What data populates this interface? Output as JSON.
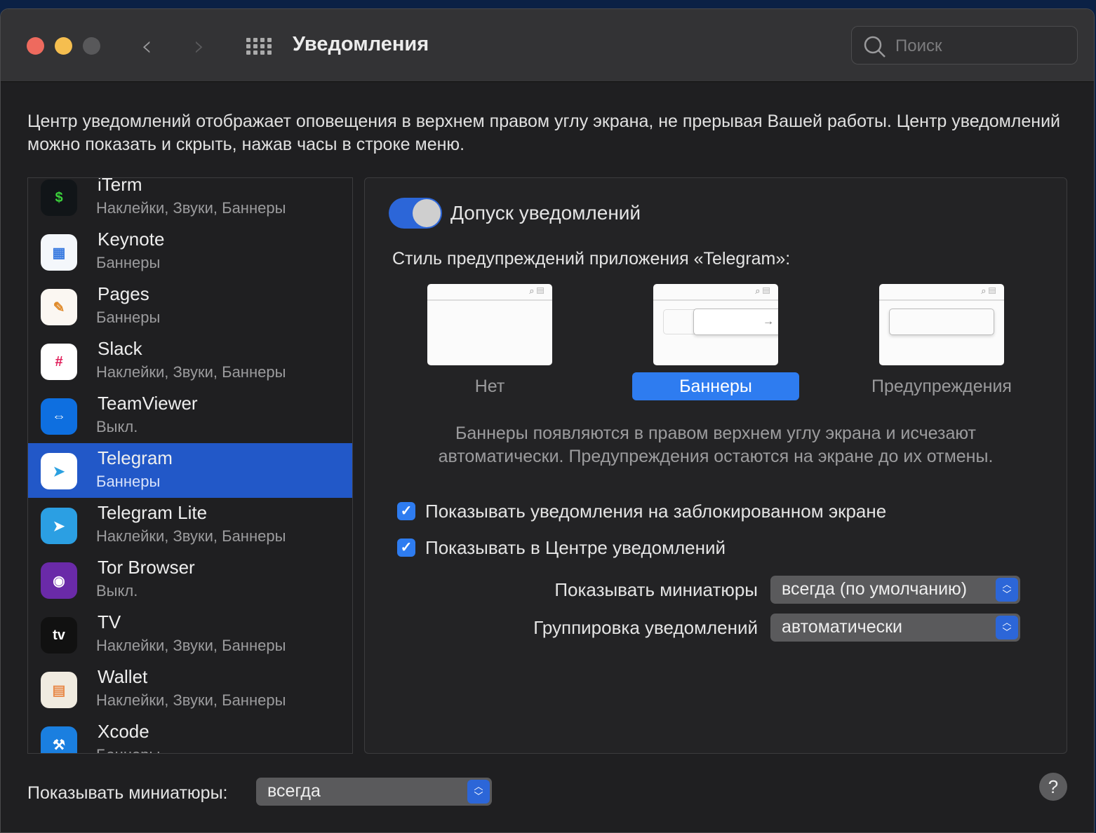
{
  "window": {
    "title": "Уведомления",
    "search_placeholder": "Поиск"
  },
  "description": "Центр уведомлений отображает оповещения в верхнем правом углу экрана, не прерывая Вашей работы. Центр уведомлений можно показать и скрыть, нажав часы в строке меню.",
  "apps": [
    {
      "name": "iTerm",
      "sub": "Наклейки, Звуки, Баннеры",
      "icon": "$",
      "bg": "#111518",
      "fg": "#3bd13b"
    },
    {
      "name": "Keynote",
      "sub": "Баннеры",
      "icon": "▦",
      "bg": "#f4f7fb",
      "fg": "#3a7be0"
    },
    {
      "name": "Pages",
      "sub": "Баннеры",
      "icon": "✎",
      "bg": "#fbf7f2",
      "fg": "#e08a2a"
    },
    {
      "name": "Slack",
      "sub": "Наклейки, Звуки, Баннеры",
      "icon": "#",
      "bg": "#ffffff",
      "fg": "#e01e5a"
    },
    {
      "name": "TeamViewer",
      "sub": "Выкл.",
      "icon": "⇔",
      "bg": "#0e6fe0",
      "fg": "#ffffff"
    },
    {
      "name": "Telegram",
      "sub": "Баннеры",
      "icon": "➤",
      "bg": "#ffffff",
      "fg": "#2aa0e0"
    },
    {
      "name": "Telegram Lite",
      "sub": "Наклейки, Звуки, Баннеры",
      "icon": "➤",
      "bg": "#2b9fe3",
      "fg": "#ffffff"
    },
    {
      "name": "Tor Browser",
      "sub": "Выкл.",
      "icon": "◉",
      "bg": "#6a2aa8",
      "fg": "#ffffff"
    },
    {
      "name": "TV",
      "sub": "Наклейки, Звуки, Баннеры",
      "icon": "tv",
      "bg": "#111",
      "fg": "#ffffff"
    },
    {
      "name": "Wallet",
      "sub": "Наклейки, Звуки, Баннеры",
      "icon": "▤",
      "bg": "#f0ebe0",
      "fg": "#e88a4a"
    },
    {
      "name": "Xcode",
      "sub": "Баннеры",
      "icon": "⚒",
      "bg": "#1a7fe0",
      "fg": "#ffffff"
    }
  ],
  "selected_app": "Telegram",
  "pane": {
    "allow_label": "Допуск уведомлений",
    "allow_on": true,
    "style_label": "Стиль предупреждений приложения «Telegram»:",
    "styles": [
      "Нет",
      "Баннеры",
      "Предупреждения"
    ],
    "style_selected": "Баннеры",
    "note": "Баннеры появляются в правом верхнем углу экрана и исчезают автоматически. Предупреждения остаются на экране до их отмены.",
    "cb_lock": "Показывать уведомления на заблокированном экране",
    "cb_lock_checked": true,
    "cb_center": "Показывать в Центре уведомлений",
    "cb_center_checked": true,
    "preview_label": "Показывать миниатюры",
    "preview_value": "всегда (по умолчанию)",
    "group_label": "Группировка уведомлений",
    "group_value": "автоматически"
  },
  "footer": {
    "preview_label": "Показывать миниатюры:",
    "preview_value": "всегда",
    "help": "?"
  }
}
